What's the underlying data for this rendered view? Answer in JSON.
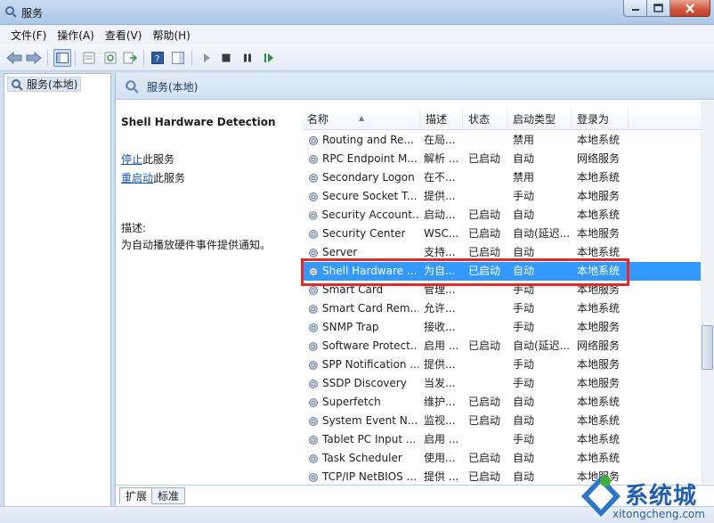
{
  "window": {
    "title": "服务"
  },
  "menu": [
    "文件(F)",
    "操作(A)",
    "查看(V)",
    "帮助(H)"
  ],
  "toolbar": {
    "icons": [
      "back-arrow-icon",
      "forward-arrow-icon",
      "console-tree-icon",
      "properties-icon",
      "refresh-icon",
      "export-list-icon",
      "help-icon",
      "show-hide-icon",
      "start-service-icon",
      "stop-service-icon",
      "pause-service-icon",
      "restart-service-icon"
    ]
  },
  "tree": {
    "root_label": "服务(本地)"
  },
  "main": {
    "header_title": "服务(本地)"
  },
  "details": {
    "service_name": "Shell Hardware Detection",
    "stop_link": "停止",
    "stop_suffix": "此服务",
    "restart_link": "重启动",
    "restart_suffix": "此服务",
    "desc_label": "描述:",
    "desc_text": "为自动播放硬件事件提供通知。"
  },
  "list": {
    "columns": [
      "名称",
      "描述",
      "状态",
      "启动类型",
      "登录为"
    ],
    "rows": [
      {
        "name": "Routing and Re...",
        "desc": "在局...",
        "status": "",
        "start": "禁用",
        "logon": "本地系统"
      },
      {
        "name": "RPC Endpoint M...",
        "desc": "解析 ...",
        "status": "已启动",
        "start": "自动",
        "logon": "网络服务"
      },
      {
        "name": "Secondary Logon",
        "desc": "在不...",
        "status": "",
        "start": "禁用",
        "logon": "本地系统"
      },
      {
        "name": "Secure Socket T...",
        "desc": "提供...",
        "status": "",
        "start": "手动",
        "logon": "本地服务"
      },
      {
        "name": "Security Account...",
        "desc": "启动...",
        "status": "已启动",
        "start": "自动",
        "logon": "本地系统"
      },
      {
        "name": "Security Center",
        "desc": "WSC...",
        "status": "已启动",
        "start": "自动(延迟...",
        "logon": "本地服务"
      },
      {
        "name": "Server",
        "desc": "支持...",
        "status": "已启动",
        "start": "自动",
        "logon": "本地系统"
      },
      {
        "name": "Shell Hardware ...",
        "desc": "为自...",
        "status": "已启动",
        "start": "自动",
        "logon": "本地系统",
        "selected": true
      },
      {
        "name": "Smart Card",
        "desc": "管理...",
        "status": "",
        "start": "手动",
        "logon": "本地服务"
      },
      {
        "name": "Smart Card Rem...",
        "desc": "允许...",
        "status": "",
        "start": "手动",
        "logon": "本地系统"
      },
      {
        "name": "SNMP Trap",
        "desc": "接收...",
        "status": "",
        "start": "手动",
        "logon": "本地服务"
      },
      {
        "name": "Software Protect...",
        "desc": "启用 ...",
        "status": "已启动",
        "start": "自动(延迟...",
        "logon": "网络服务"
      },
      {
        "name": "SPP Notification ...",
        "desc": "提供...",
        "status": "",
        "start": "手动",
        "logon": "本地服务"
      },
      {
        "name": "SSDP Discovery",
        "desc": "当发...",
        "status": "",
        "start": "手动",
        "logon": "本地服务"
      },
      {
        "name": "Superfetch",
        "desc": "维护...",
        "status": "已启动",
        "start": "自动",
        "logon": "本地系统"
      },
      {
        "name": "System Event N...",
        "desc": "监视...",
        "status": "已启动",
        "start": "自动",
        "logon": "本地系统"
      },
      {
        "name": "Tablet PC Input ...",
        "desc": "启用 ...",
        "status": "",
        "start": "手动",
        "logon": "本地系统"
      },
      {
        "name": "Task Scheduler",
        "desc": "使用...",
        "status": "已启动",
        "start": "自动",
        "logon": "本地系统"
      },
      {
        "name": "TCP/IP NetBIOS ...",
        "desc": "提供 ...",
        "status": "已启动",
        "start": "自动",
        "logon": "本地服务"
      }
    ]
  },
  "tabs": [
    "扩展",
    "标准"
  ],
  "watermark": {
    "brand": "系统城",
    "url": "xitongcheng.com"
  }
}
